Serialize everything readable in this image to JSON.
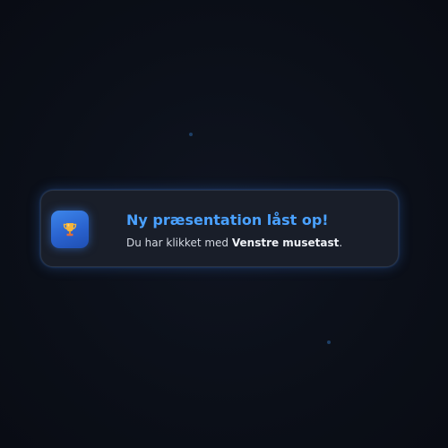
{
  "notification": {
    "icon": "trophy-icon",
    "title": "Ny præsentation låst op!",
    "message_prefix": "Du har klikket med ",
    "message_bold": "Venstre musetast",
    "message_suffix": "."
  },
  "colors": {
    "background": "#0c1019",
    "card": "#191e29",
    "title": "#4aa1ff",
    "badge": "#2a63cf"
  }
}
